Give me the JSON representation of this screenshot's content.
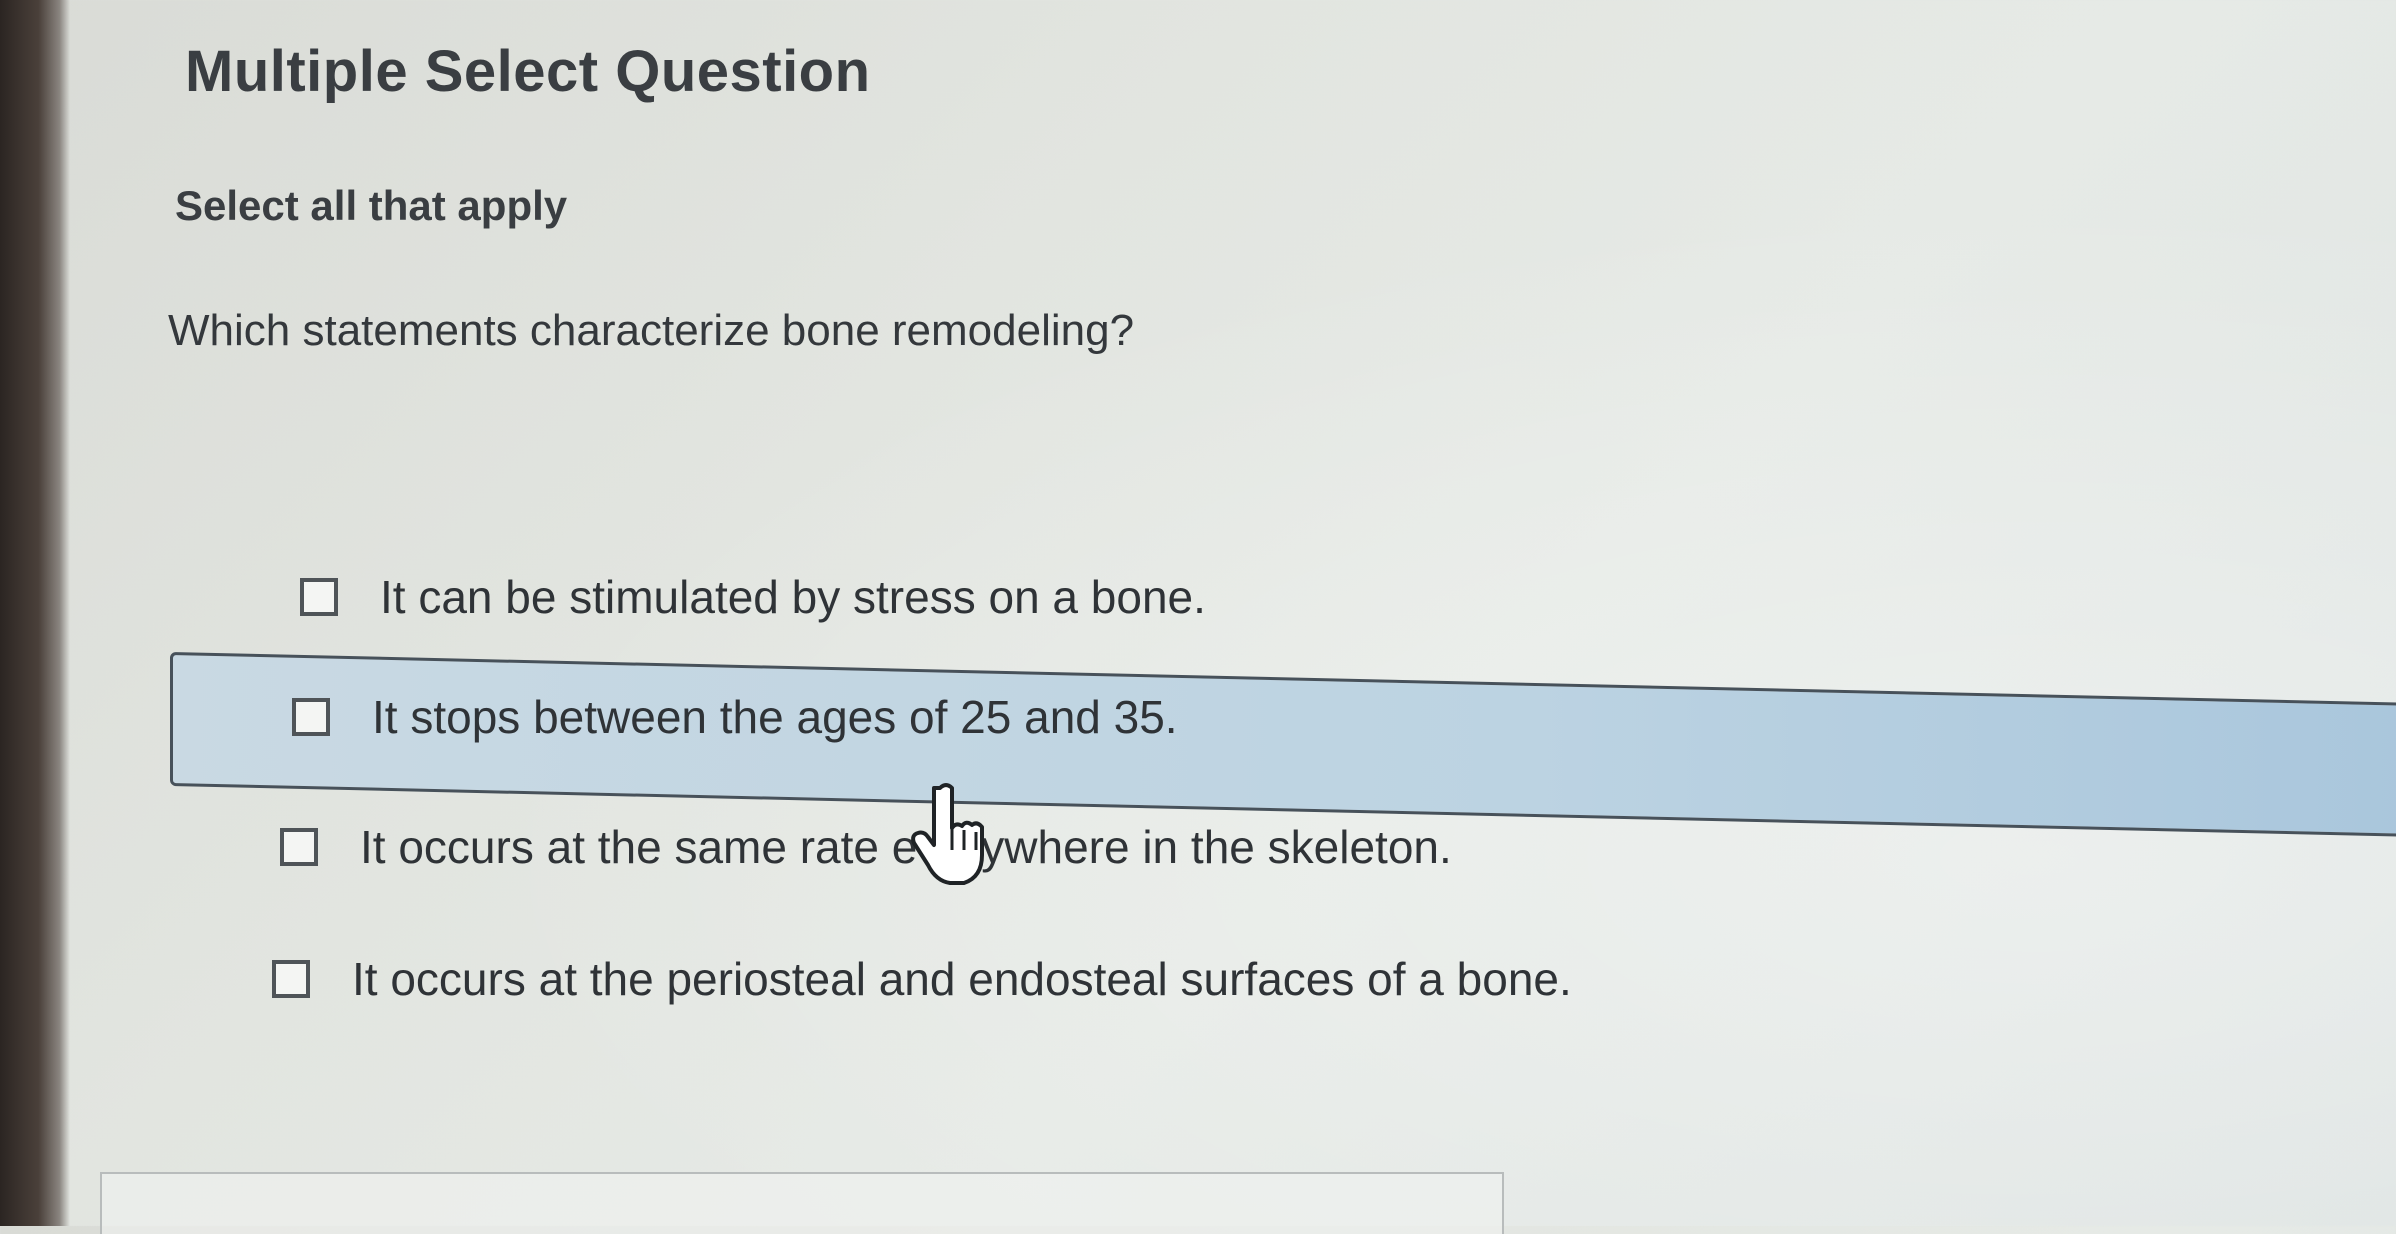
{
  "question": {
    "type_label": "Multiple Select Question",
    "instruction": "Select all that apply",
    "prompt": "Which statements characterize bone remodeling?",
    "options": [
      {
        "label": "It can be stimulated by stress on a bone.",
        "checked": false
      },
      {
        "label": "It stops between the ages of 25 and 35.",
        "checked": false,
        "hovered": true
      },
      {
        "label": "It occurs at the same rate everywhere in the skeleton.",
        "checked": false
      },
      {
        "label": "It occurs at the periosteal and endosteal surfaces of a bone.",
        "checked": false
      }
    ]
  },
  "colors": {
    "highlight": "#bcd3e2",
    "text": "#2f3337"
  },
  "cursor_icon": "hand-pointer-icon"
}
